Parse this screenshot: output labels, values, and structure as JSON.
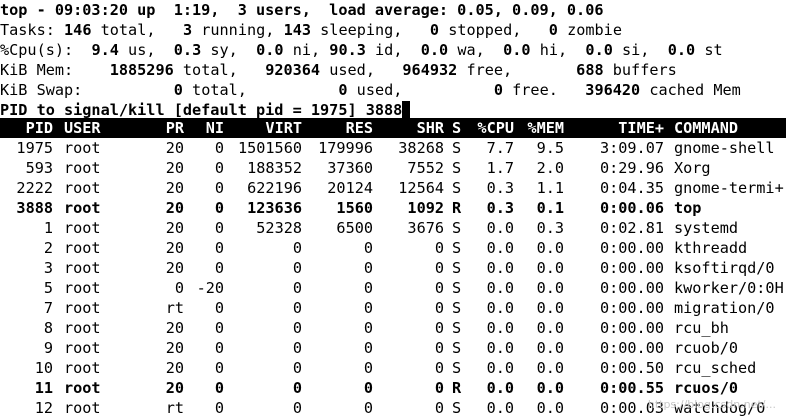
{
  "summary": {
    "line1": "top - 09:03:20 up  1:19,  3 users,  load average: 0.05, 0.09, 0.06",
    "tasks": {
      "label": "Tasks:",
      "total": "146",
      "total_label": "total,",
      "running": "3",
      "running_label": "running,",
      "sleeping": "143",
      "sleeping_label": "sleeping,",
      "stopped": "0",
      "stopped_label": "stopped,",
      "zombie": "0",
      "zombie_label": "zombie"
    },
    "cpu": {
      "label": "%Cpu(s):",
      "us": "9.4",
      "sy": "0.3",
      "ni": "0.0",
      "id": "90.3",
      "wa": "0.0",
      "hi": "0.0",
      "si": "0.0",
      "st": "0.0",
      "us_label": "us,",
      "sy_label": "sy,",
      "ni_label": "ni,",
      "id_label": "id,",
      "wa_label": "wa,",
      "hi_label": "hi,",
      "si_label": "si,",
      "st_label": "st"
    },
    "mem": {
      "label": "KiB Mem:",
      "total": "1885296",
      "total_label": "total,",
      "used": "920364",
      "used_label": "used,",
      "free": "964932",
      "free_label": "free,",
      "buffers": "688",
      "buffers_label": "buffers"
    },
    "swap": {
      "label": "KiB Swap:",
      "total": "0",
      "total_label": "total,",
      "used": "0",
      "used_label": "used,",
      "free": "0",
      "free_label": "free.",
      "cached": "396420",
      "cached_label": "cached Mem"
    },
    "prompt": {
      "text": "PID to signal/kill [default pid = 1975] ",
      "input_value": "3888"
    }
  },
  "table": {
    "columns": [
      "PID",
      "USER",
      "PR",
      "NI",
      "VIRT",
      "RES",
      "SHR",
      "S",
      "%CPU",
      "%MEM",
      "TIME+",
      "COMMAND"
    ],
    "rows": [
      {
        "pid": "1975",
        "user": "root",
        "pr": "20",
        "ni": "0",
        "virt": "1501560",
        "res": "179996",
        "shr": "38268",
        "s": "S",
        "cpu": "7.7",
        "mem": "9.5",
        "time": "3:09.07",
        "command": "gnome-shell"
      },
      {
        "pid": "593",
        "user": "root",
        "pr": "20",
        "ni": "0",
        "virt": "188352",
        "res": "37360",
        "shr": "7552",
        "s": "S",
        "cpu": "1.7",
        "mem": "2.0",
        "time": "0:29.96",
        "command": "Xorg"
      },
      {
        "pid": "2222",
        "user": "root",
        "pr": "20",
        "ni": "0",
        "virt": "622196",
        "res": "20124",
        "shr": "12564",
        "s": "S",
        "cpu": "0.3",
        "mem": "1.1",
        "time": "0:04.35",
        "command": "gnome-termi+"
      },
      {
        "pid": "3888",
        "user": "root",
        "pr": "20",
        "ni": "0",
        "virt": "123636",
        "res": "1560",
        "shr": "1092",
        "s": "R",
        "cpu": "0.3",
        "mem": "0.1",
        "time": "0:00.06",
        "command": "top",
        "bold": true
      },
      {
        "pid": "1",
        "user": "root",
        "pr": "20",
        "ni": "0",
        "virt": "52328",
        "res": "6500",
        "shr": "3676",
        "s": "S",
        "cpu": "0.0",
        "mem": "0.3",
        "time": "0:02.81",
        "command": "systemd"
      },
      {
        "pid": "2",
        "user": "root",
        "pr": "20",
        "ni": "0",
        "virt": "0",
        "res": "0",
        "shr": "0",
        "s": "S",
        "cpu": "0.0",
        "mem": "0.0",
        "time": "0:00.00",
        "command": "kthreadd"
      },
      {
        "pid": "3",
        "user": "root",
        "pr": "20",
        "ni": "0",
        "virt": "0",
        "res": "0",
        "shr": "0",
        "s": "S",
        "cpu": "0.0",
        "mem": "0.0",
        "time": "0:00.00",
        "command": "ksoftirqd/0"
      },
      {
        "pid": "5",
        "user": "root",
        "pr": "0",
        "ni": "-20",
        "virt": "0",
        "res": "0",
        "shr": "0",
        "s": "S",
        "cpu": "0.0",
        "mem": "0.0",
        "time": "0:00.00",
        "command": "kworker/0:0H"
      },
      {
        "pid": "7",
        "user": "root",
        "pr": "rt",
        "ni": "0",
        "virt": "0",
        "res": "0",
        "shr": "0",
        "s": "S",
        "cpu": "0.0",
        "mem": "0.0",
        "time": "0:00.00",
        "command": "migration/0"
      },
      {
        "pid": "8",
        "user": "root",
        "pr": "20",
        "ni": "0",
        "virt": "0",
        "res": "0",
        "shr": "0",
        "s": "S",
        "cpu": "0.0",
        "mem": "0.0",
        "time": "0:00.00",
        "command": "rcu_bh"
      },
      {
        "pid": "9",
        "user": "root",
        "pr": "20",
        "ni": "0",
        "virt": "0",
        "res": "0",
        "shr": "0",
        "s": "S",
        "cpu": "0.0",
        "mem": "0.0",
        "time": "0:00.00",
        "command": "rcuob/0"
      },
      {
        "pid": "10",
        "user": "root",
        "pr": "20",
        "ni": "0",
        "virt": "0",
        "res": "0",
        "shr": "0",
        "s": "S",
        "cpu": "0.0",
        "mem": "0.0",
        "time": "0:00.50",
        "command": "rcu_sched"
      },
      {
        "pid": "11",
        "user": "root",
        "pr": "20",
        "ni": "0",
        "virt": "0",
        "res": "0",
        "shr": "0",
        "s": "R",
        "cpu": "0.0",
        "mem": "0.0",
        "time": "0:00.55",
        "command": "rcuos/0",
        "bold": true
      },
      {
        "pid": "12",
        "user": "root",
        "pr": "rt",
        "ni": "0",
        "virt": "0",
        "res": "0",
        "shr": "0",
        "s": "S",
        "cpu": "0.0",
        "mem": "0.0",
        "time": "0:00.03",
        "command": "watchdog/0"
      }
    ]
  },
  "watermark": "https://blog.csdn.net/..."
}
